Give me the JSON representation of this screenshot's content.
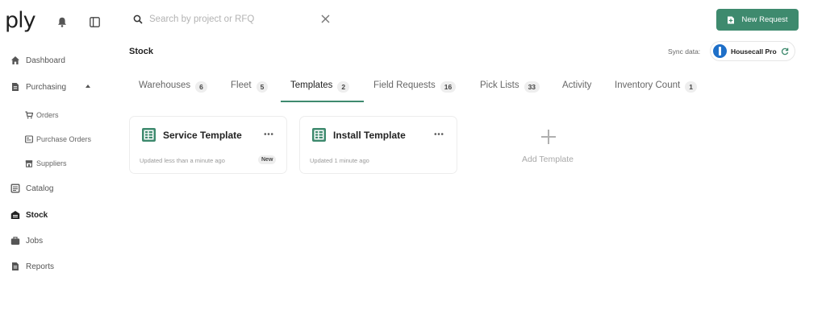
{
  "app": {
    "logo_text": "ply"
  },
  "search": {
    "placeholder": "Search by project or RFQ",
    "value": ""
  },
  "header": {
    "new_request_label": "New Request",
    "page_title": "Stock"
  },
  "sync": {
    "label": "Sync data:",
    "integration_name": "Housecall Pro"
  },
  "sidebar": {
    "items": [
      {
        "label": "Dashboard",
        "icon": "home-icon"
      },
      {
        "label": "Purchasing",
        "icon": "document-icon",
        "expanded": true
      },
      {
        "label": "Orders",
        "icon": "cart-icon"
      },
      {
        "label": "Purchase Orders",
        "icon": "purchase-order-icon"
      },
      {
        "label": "Suppliers",
        "icon": "store-icon"
      },
      {
        "label": "Catalog",
        "icon": "catalog-icon"
      },
      {
        "label": "Stock",
        "icon": "warehouse-icon",
        "active": true
      },
      {
        "label": "Jobs",
        "icon": "briefcase-icon"
      },
      {
        "label": "Reports",
        "icon": "report-icon"
      }
    ]
  },
  "tabs": [
    {
      "label": "Warehouses",
      "count": "6"
    },
    {
      "label": "Fleet",
      "count": "5"
    },
    {
      "label": "Templates",
      "count": "2",
      "active": true
    },
    {
      "label": "Field Requests",
      "count": "16"
    },
    {
      "label": "Pick Lists",
      "count": "33"
    },
    {
      "label": "Activity",
      "count": ""
    },
    {
      "label": "Inventory Count",
      "count": "1"
    }
  ],
  "templates": [
    {
      "title": "Service Template",
      "updated": "Updated less than a minute ago",
      "badge": "New"
    },
    {
      "title": "Install Template",
      "updated": "Updated 1 minute ago",
      "badge": ""
    }
  ],
  "add_template_label": "Add Template",
  "colors": {
    "accent": "#3e8a6e",
    "integration_blue": "#1e6fc8"
  }
}
